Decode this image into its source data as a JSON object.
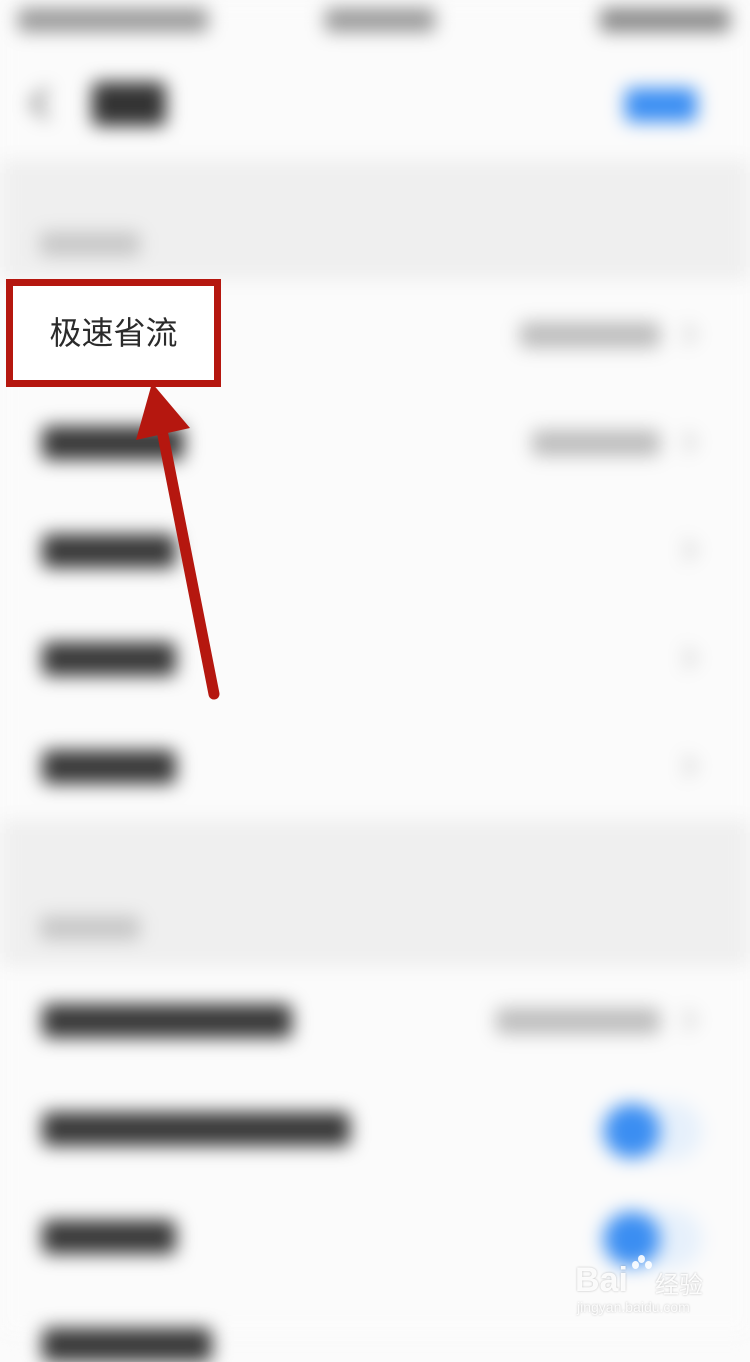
{
  "annotation": {
    "label": "极速省流"
  },
  "watermark": {
    "brand": "Bai",
    "brand_suffix": "经验",
    "url": "jingyan.baidu.com"
  },
  "icons": {
    "back": "chevron-left-icon",
    "row_arrow": "chevron-right-icon",
    "paw": "baidu-paw-icon"
  },
  "colors": {
    "accent": "#3b8ef2",
    "annotation_red": "#b5170f"
  }
}
